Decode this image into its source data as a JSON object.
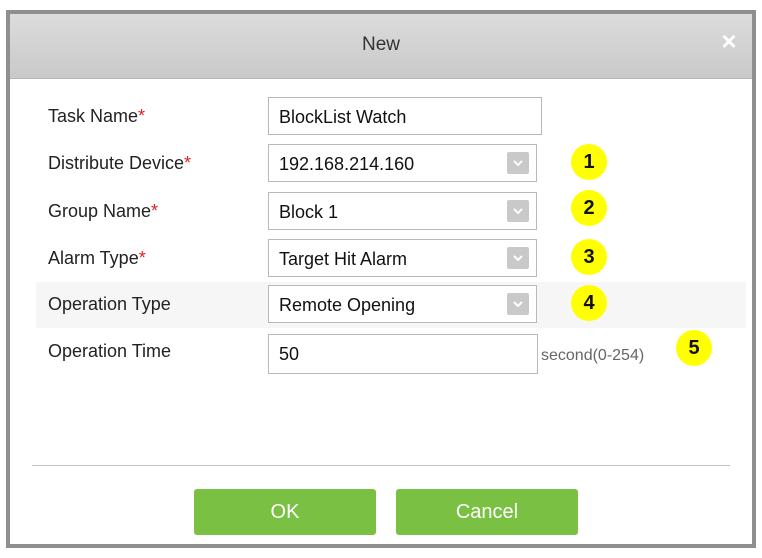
{
  "dialog": {
    "title": "New",
    "close_symbol": "×"
  },
  "form": {
    "required_mark": "*",
    "task_name": {
      "label": "Task Name",
      "value": "BlockList Watch"
    },
    "distribute_device": {
      "label": "Distribute Device",
      "value": "192.168.214.160",
      "badge": "1"
    },
    "group_name": {
      "label": "Group Name",
      "value": "Block 1",
      "badge": "2"
    },
    "alarm_type": {
      "label": "Alarm Type",
      "value": "Target Hit Alarm",
      "badge": "3"
    },
    "operation_type": {
      "label": "Operation Type",
      "value": "Remote Opening",
      "badge": "4"
    },
    "operation_time": {
      "label": "Operation Time",
      "value": "50",
      "unit": "second(0-254)",
      "badge": "5"
    }
  },
  "buttons": {
    "ok": "OK",
    "cancel": "Cancel"
  },
  "colors": {
    "button_green": "#7ac143",
    "badge_yellow": "#ffff00",
    "required_red": "#e02020"
  },
  "icons": {
    "dropdown": "chevron-down-icon",
    "close": "close-icon"
  }
}
